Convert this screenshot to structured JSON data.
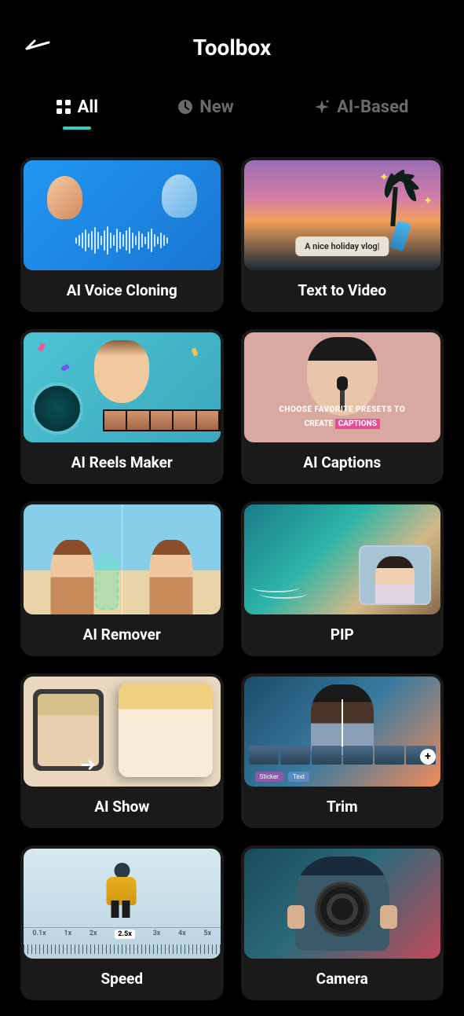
{
  "header": {
    "title": "Toolbox"
  },
  "tabs": {
    "all": {
      "label": "All",
      "active": true
    },
    "new": {
      "label": "New",
      "active": false
    },
    "ai": {
      "label": "AI-Based",
      "active": false
    }
  },
  "text_to_video_pill": "A nice holiday vlog|",
  "captions_line1": "CHOOSE  FAVORITE PRESETS TO",
  "captions_line2_pre": "CREATE ",
  "captions_line2_hl": "CAPTIONS",
  "trim_tags": {
    "sticker": "Sticker",
    "text": "Text"
  },
  "speed_marks": {
    "a": "0.1x",
    "b": "1x",
    "c": "2x",
    "d": "2.5x",
    "e": "3x",
    "f": "4x",
    "g": "5x"
  },
  "cards": {
    "voice": {
      "label": "AI Voice Cloning"
    },
    "text": {
      "label": "Text  to Video"
    },
    "reels": {
      "label": "AI Reels Maker"
    },
    "captions": {
      "label": "AI Captions"
    },
    "remover": {
      "label": "AI Remover"
    },
    "pip": {
      "label": "PIP"
    },
    "show": {
      "label": "AI Show"
    },
    "trim": {
      "label": "Trim"
    },
    "speed": {
      "label": "Speed"
    },
    "camera": {
      "label": "Camera"
    }
  }
}
